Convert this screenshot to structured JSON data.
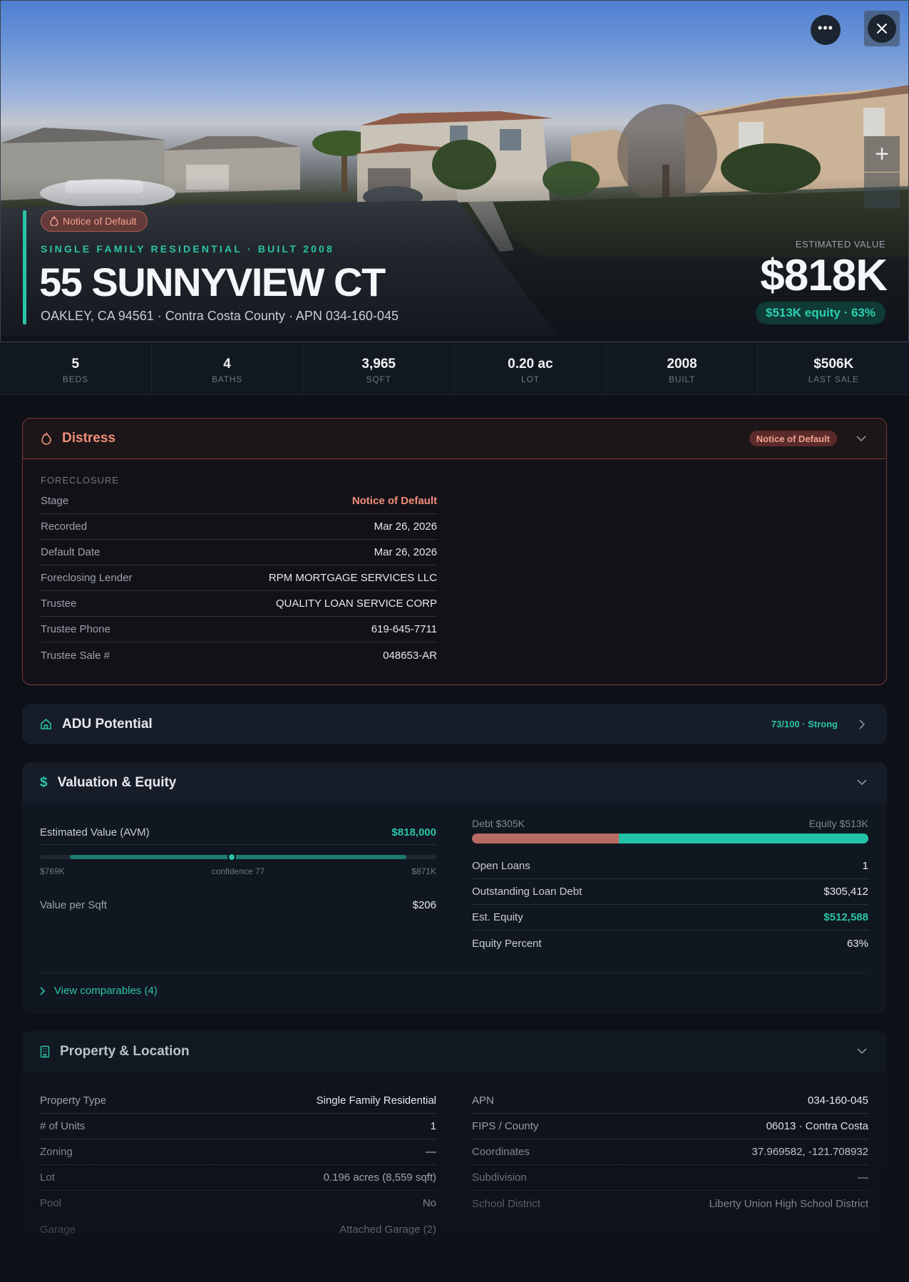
{
  "hero": {
    "badge": "Notice of Default",
    "subtype": "SINGLE FAMILY RESIDENTIAL · BUILT 2008",
    "address": "55 SUNNYVIEW CT",
    "location": "OAKLEY, CA 94561 · Contra Costa County · APN 034-160-045",
    "est_label": "ESTIMATED VALUE",
    "est_value": "$818K",
    "equity": "$513K equity · 63%",
    "more_icon": "ellipsis-icon",
    "close_icon": "close-icon"
  },
  "stats": [
    {
      "value": "5",
      "label": "BEDS"
    },
    {
      "value": "4",
      "label": "BATHS"
    },
    {
      "value": "3,965",
      "label": "SQFT"
    },
    {
      "value": "0.20 ac",
      "label": "LOT"
    },
    {
      "value": "2008",
      "label": "BUILT"
    },
    {
      "value": "$506K",
      "label": "LAST SALE"
    }
  ],
  "distress": {
    "title": "Distress",
    "badge": "Notice of Default",
    "section": "FORECLOSURE",
    "rows": [
      {
        "k": "Stage",
        "v": "Notice of Default"
      },
      {
        "k": "Recorded",
        "v": "Mar 26, 2026"
      },
      {
        "k": "Default Date",
        "v": "Mar 26, 2026"
      },
      {
        "k": "Foreclosing Lender",
        "v": "RPM MORTGAGE SERVICES LLC"
      },
      {
        "k": "Trustee",
        "v": "QUALITY LOAN SERVICE CORP"
      },
      {
        "k": "Trustee Phone",
        "v": "619-645-7711"
      },
      {
        "k": "Trustee Sale #",
        "v": "048653-AR"
      }
    ]
  },
  "adu": {
    "title": "ADU Potential",
    "score": "73/100 · Strong"
  },
  "valuation": {
    "title": "Valuation & Equity",
    "avm_label": "Estimated Value (AVM)",
    "avm_value": "$818,000",
    "avm_low": "$769K",
    "avm_high": "$871K",
    "avm_low_num": 769,
    "avm_high_num": 871,
    "avm_num": 818,
    "confidence": "confidence 77",
    "psf_label": "Value per Sqft",
    "psf_value": "$206",
    "debt_label": "Debt $305K",
    "equity_label": "Equity $513K",
    "equity_fraction": 0.63,
    "rows": [
      {
        "k": "Open Loans",
        "v": "1"
      },
      {
        "k": "Outstanding Loan Debt",
        "v": "$305,412"
      },
      {
        "k": "Est. Equity",
        "v": "$512,588"
      },
      {
        "k": "Equity Percent",
        "v": "63%"
      }
    ],
    "comps": "View comparables (4)"
  },
  "property": {
    "title": "Property & Location",
    "left": [
      {
        "k": "Property Type",
        "v": "Single Family Residential"
      },
      {
        "k": "# of Units",
        "v": "1"
      },
      {
        "k": "Zoning",
        "v": "—"
      },
      {
        "k": "Lot",
        "v": "0.196 acres (8,559 sqft)"
      },
      {
        "k": "Pool",
        "v": "No"
      },
      {
        "k": "Garage",
        "v": "Attached Garage (2)"
      }
    ],
    "right": [
      {
        "k": "APN",
        "v": "034-160-045"
      },
      {
        "k": "FIPS / County",
        "v": "06013 · Contra Costa"
      },
      {
        "k": "Coordinates",
        "v": "37.969582, -121.708932"
      },
      {
        "k": "Subdivision",
        "v": "—"
      },
      {
        "k": "School District",
        "v": "Liberty Union High School District"
      }
    ]
  },
  "colors": {
    "accent": "#2bc4a8",
    "distress": "#f08f79",
    "debt": "#b86b63"
  }
}
